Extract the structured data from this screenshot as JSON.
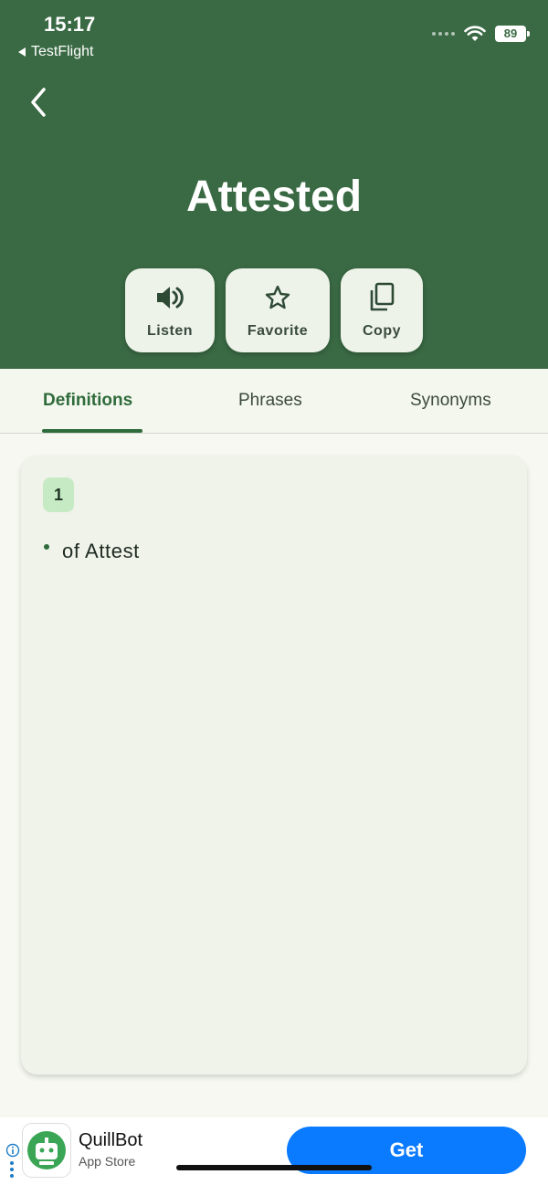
{
  "status_bar": {
    "time": "15:17",
    "back_app": "TestFlight",
    "battery": "89"
  },
  "header": {
    "word": "Attested",
    "actions": [
      {
        "label": "Listen",
        "icon": "speaker-icon"
      },
      {
        "label": "Favorite",
        "icon": "star-outline-icon"
      },
      {
        "label": "Copy",
        "icon": "copy-icon"
      }
    ],
    "background_color": "#3a6a44"
  },
  "tabs": [
    {
      "label": "Definitions",
      "active": true
    },
    {
      "label": "Phrases",
      "active": false
    },
    {
      "label": "Synonyms",
      "active": false
    }
  ],
  "definitions": [
    {
      "number": "1",
      "text": "of Attest"
    }
  ],
  "ad": {
    "app_name": "QuillBot",
    "store": "App Store",
    "cta": "Get",
    "cta_color": "#0a7aff"
  }
}
